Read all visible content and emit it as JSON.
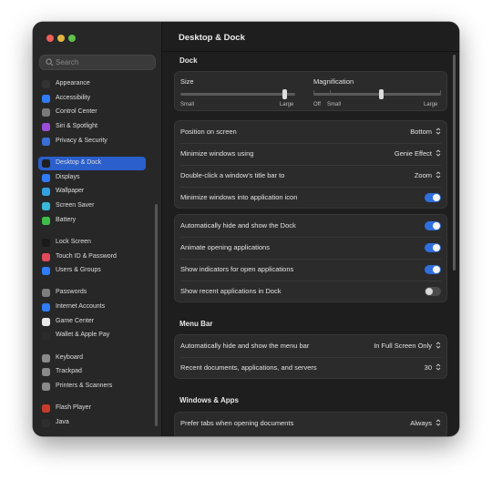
{
  "window": {
    "title": "Desktop & Dock"
  },
  "search": {
    "placeholder": "Search"
  },
  "sidebar": {
    "items": [
      {
        "label": "Appearance",
        "icon": "appearance-icon",
        "color": "#333333"
      },
      {
        "label": "Accessibility",
        "icon": "accessibility-icon",
        "color": "#2f7cf6"
      },
      {
        "label": "Control Center",
        "icon": "control-center-icon",
        "color": "#7a7a7a"
      },
      {
        "label": "Siri & Spotlight",
        "icon": "siri-icon",
        "color": "#9b4dd6"
      },
      {
        "label": "Privacy & Security",
        "icon": "privacy-icon",
        "color": "#3a6fd8"
      },
      {
        "label": "Desktop & Dock",
        "icon": "desktop-dock-icon",
        "color": "#1f1f1f"
      },
      {
        "label": "Displays",
        "icon": "displays-icon",
        "color": "#2f7cf6"
      },
      {
        "label": "Wallpaper",
        "icon": "wallpaper-icon",
        "color": "#34a0e0"
      },
      {
        "label": "Screen Saver",
        "icon": "screen-saver-icon",
        "color": "#39b7d8"
      },
      {
        "label": "Battery",
        "icon": "battery-icon",
        "color": "#3fbf4a"
      },
      {
        "label": "Lock Screen",
        "icon": "lock-screen-icon",
        "color": "#1a1a1a"
      },
      {
        "label": "Touch ID & Password",
        "icon": "touch-id-icon",
        "color": "#e04a5a"
      },
      {
        "label": "Users & Groups",
        "icon": "users-groups-icon",
        "color": "#2f7cf6"
      },
      {
        "label": "Passwords",
        "icon": "passwords-icon",
        "color": "#7d7d7d"
      },
      {
        "label": "Internet Accounts",
        "icon": "internet-accounts-icon",
        "color": "#2f7cf6"
      },
      {
        "label": "Game Center",
        "icon": "game-center-icon",
        "color": "#e9e9e9"
      },
      {
        "label": "Wallet & Apple Pay",
        "icon": "wallet-icon",
        "color": "#2b2b2b"
      },
      {
        "label": "Keyboard",
        "icon": "keyboard-icon",
        "color": "#8a8a8a"
      },
      {
        "label": "Trackpad",
        "icon": "trackpad-icon",
        "color": "#8a8a8a"
      },
      {
        "label": "Printers & Scanners",
        "icon": "printers-icon",
        "color": "#8a8a8a"
      },
      {
        "label": "Flash Player",
        "icon": "flash-player-icon",
        "color": "#c83a2a"
      },
      {
        "label": "Java",
        "icon": "java-icon",
        "color": "#2f2f2f"
      }
    ],
    "selected": "Desktop & Dock"
  },
  "dock": {
    "section": "Dock",
    "size": {
      "label": "Size",
      "min": "Small",
      "max": "Large",
      "value": 0.85
    },
    "magnification": {
      "label": "Magnification",
      "off": "Off",
      "min": "Small",
      "max": "Large",
      "value": 0.5
    },
    "position": {
      "label": "Position on screen",
      "value": "Bottom"
    },
    "minimize": {
      "label": "Minimize windows using",
      "value": "Genie Effect"
    },
    "double_click": {
      "label": "Double-click a window's title bar to",
      "value": "Zoom"
    },
    "minimize_into_icon": {
      "label": "Minimize windows into application icon",
      "on": true
    },
    "autohide": {
      "label": "Automatically hide and show the Dock",
      "on": true
    },
    "animate": {
      "label": "Animate opening applications",
      "on": true
    },
    "indicators": {
      "label": "Show indicators for open applications",
      "on": true
    },
    "recent": {
      "label": "Show recent applications in Dock",
      "on": false
    }
  },
  "menu_bar": {
    "section": "Menu Bar",
    "autohide": {
      "label": "Automatically hide and show the menu bar",
      "value": "In Full Screen Only"
    },
    "recent_docs": {
      "label": "Recent documents, applications, and servers",
      "value": "30"
    }
  },
  "windows_apps": {
    "section": "Windows & Apps",
    "prefer_tabs": {
      "label": "Prefer tabs when opening documents",
      "value": "Always"
    }
  }
}
